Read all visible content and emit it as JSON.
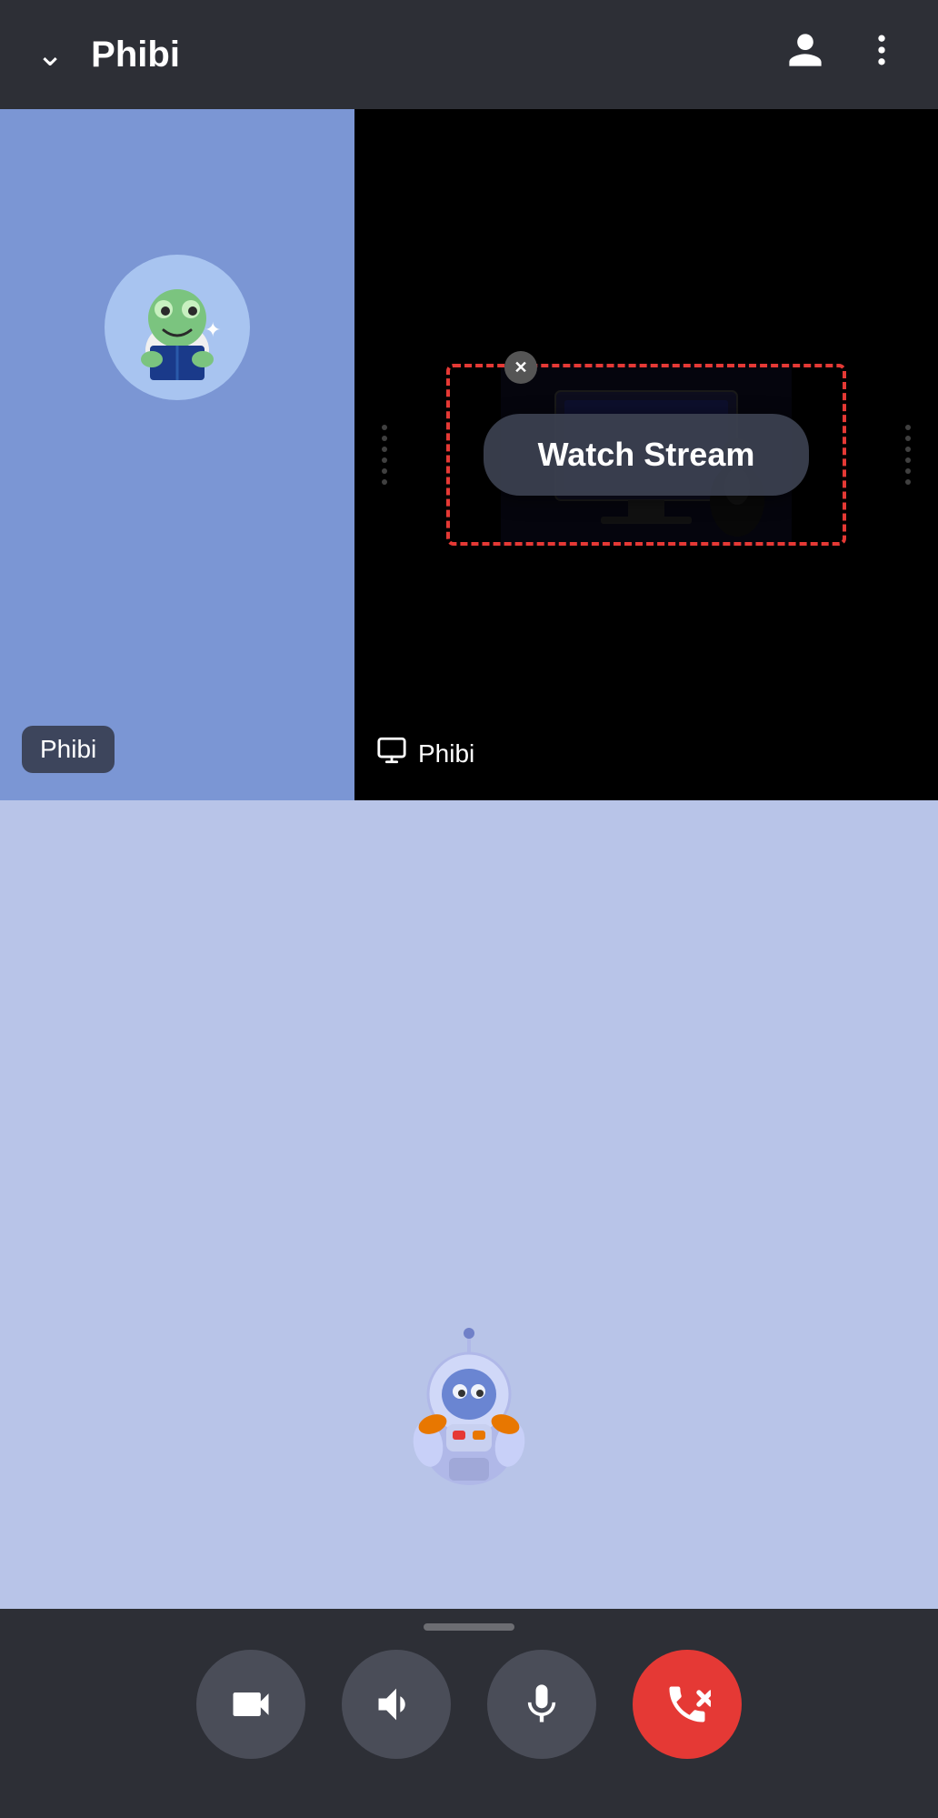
{
  "header": {
    "title": "Phibi",
    "chevron": "chevron-down",
    "person_icon": "person",
    "more_icon": "more-vertical"
  },
  "video_left": {
    "user_name": "Phibi",
    "avatar_emoji": "🐸"
  },
  "video_right": {
    "watch_stream_label": "Watch Stream",
    "share_label": "Phibi"
  },
  "bottom_panel": {
    "robot_emoji": "🤖"
  },
  "controls": {
    "camera_label": "camera",
    "speaker_label": "speaker",
    "mic_label": "microphone",
    "end_call_label": "end call"
  }
}
